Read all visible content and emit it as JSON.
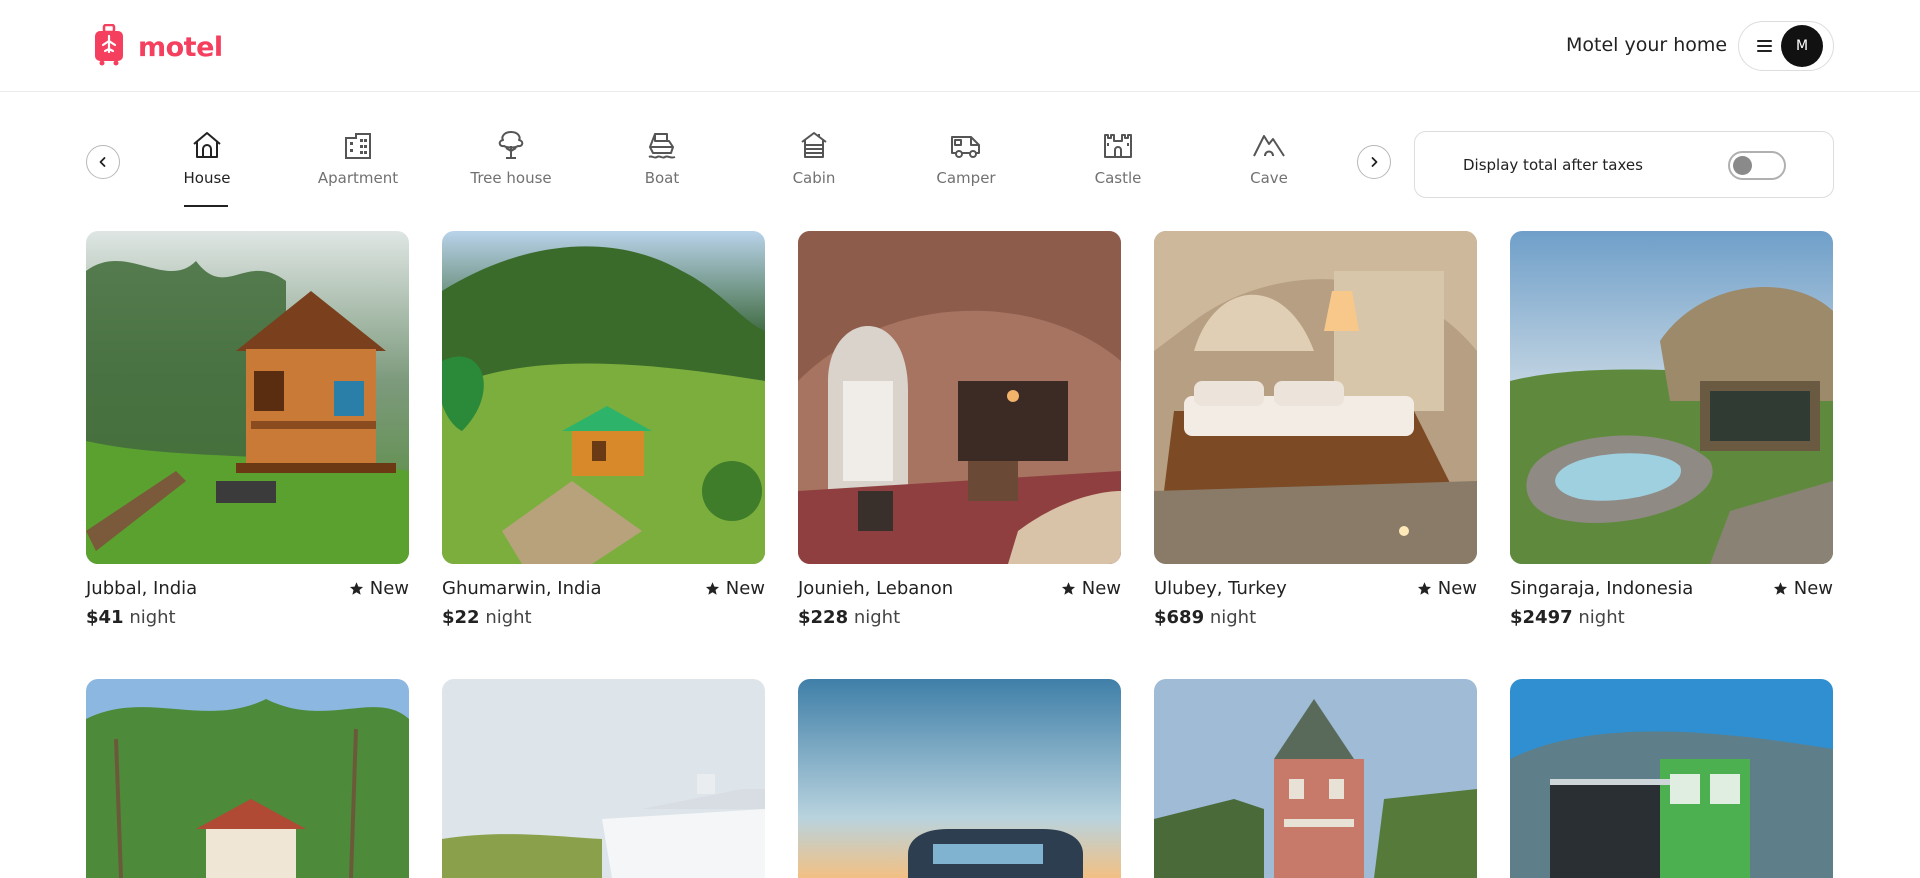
{
  "app": {
    "name": "motel"
  },
  "header": {
    "host_link": "Motel your home",
    "avatar_initial": "M"
  },
  "categories": [
    {
      "label": "House",
      "icon": "house-icon",
      "active": true
    },
    {
      "label": "Apartment",
      "icon": "apartment-icon",
      "active": false
    },
    {
      "label": "Tree house",
      "icon": "tree-house-icon",
      "active": false
    },
    {
      "label": "Boat",
      "icon": "boat-icon",
      "active": false
    },
    {
      "label": "Cabin",
      "icon": "cabin-icon",
      "active": false
    },
    {
      "label": "Camper",
      "icon": "camper-icon",
      "active": false
    },
    {
      "label": "Castle",
      "icon": "castle-icon",
      "active": false
    },
    {
      "label": "Cave",
      "icon": "cave-icon",
      "active": false
    }
  ],
  "tax_toggle": {
    "label": "Display total after taxes",
    "enabled": false
  },
  "listings": [
    {
      "location": "Jubbal, India",
      "rating": "New",
      "price": "$41",
      "unit": "night"
    },
    {
      "location": "Ghumarwin, India",
      "rating": "New",
      "price": "$22",
      "unit": "night"
    },
    {
      "location": "Jounieh, Lebanon",
      "rating": "New",
      "price": "$228",
      "unit": "night"
    },
    {
      "location": "Ulubey, Turkey",
      "rating": "New",
      "price": "$689",
      "unit": "night"
    },
    {
      "location": "Singaraja, Indonesia",
      "rating": "New",
      "price": "$2497",
      "unit": "night"
    }
  ],
  "colors": {
    "brand": "#f43f5e",
    "text": "#222222",
    "muted": "#717171",
    "border": "#dddddd"
  }
}
